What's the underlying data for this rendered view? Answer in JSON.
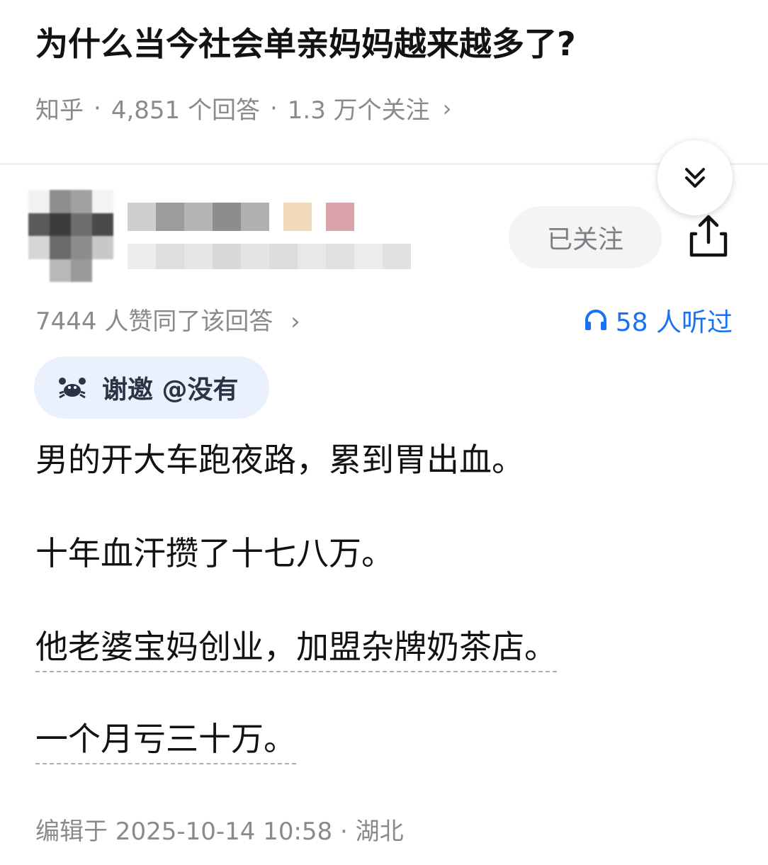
{
  "question": {
    "title": "为什么当今社会单亲妈妈越来越多了?",
    "source": "知乎",
    "answers": "4,851 个回答",
    "followers": "1.3 万个关注",
    "chevron": "›"
  },
  "author": {
    "follow_label": "已关注"
  },
  "answer_meta": {
    "upvotes": "7444 人赞同了该回答",
    "upvotes_chevron": "›",
    "listen": "58 人听过"
  },
  "invite": {
    "label": "谢邀 @没有"
  },
  "body": {
    "paragraphs": [
      "男的开大车跑夜路，累到胃出血。",
      "十年血汗攒了十七八万。",
      "他老婆宝妈创业，加盟杂牌奶茶店。",
      "一个月亏三十万。"
    ]
  },
  "footer": {
    "edited": "编辑于 2025-10-14 10:58 · 湖北"
  },
  "colors": {
    "accent": "#1772f6",
    "muted": "#8a8a8a",
    "chip_bg": "#eaf1fd"
  },
  "icons": [
    "double-chevron-down-icon",
    "share-icon",
    "headphones-icon",
    "crab-icon"
  ]
}
